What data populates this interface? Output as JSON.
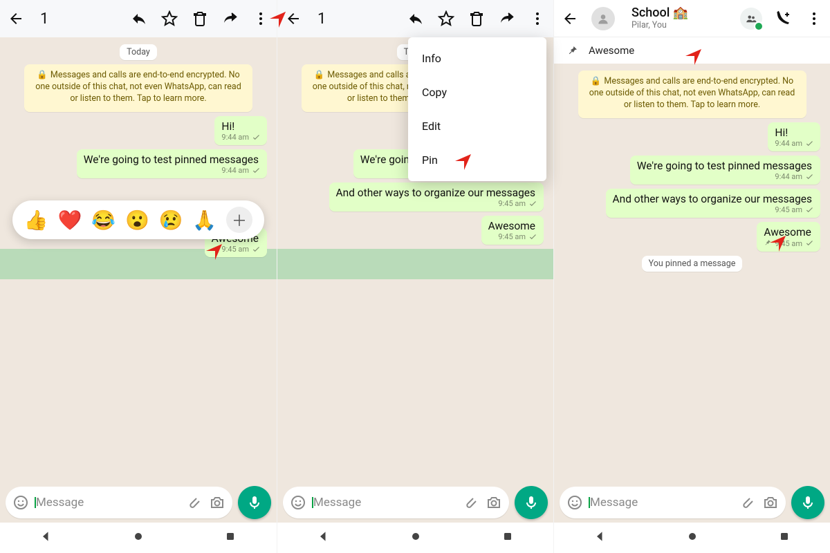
{
  "labels": {
    "today": "Today",
    "encryption": "Messages and calls are end-to-end encrypted. No one outside of this chat, not even WhatsApp, can read or listen to them. Tap to learn more.",
    "placeholder": "Message",
    "pinned_system": "You pinned a message"
  },
  "selection_count": "1",
  "group": {
    "name": "School 🏫",
    "subtitle": "Pilar, You"
  },
  "pinned_banner": "Awesome",
  "menu": {
    "info": "Info",
    "copy": "Copy",
    "edit": "Edit",
    "pin": "Pin"
  },
  "emojis": [
    "👍",
    "❤️",
    "😂",
    "😮",
    "😢",
    "🙏"
  ],
  "msgs": {
    "hi": {
      "text": "Hi!",
      "time": "9:44 am"
    },
    "test": {
      "text": "We're going to test pinned messages",
      "time": "9:44 am"
    },
    "other": {
      "text": "And other ways to organize our messages",
      "time": "9:45 am"
    },
    "awesome": {
      "text": "Awesome",
      "time": "9:45 am"
    }
  }
}
